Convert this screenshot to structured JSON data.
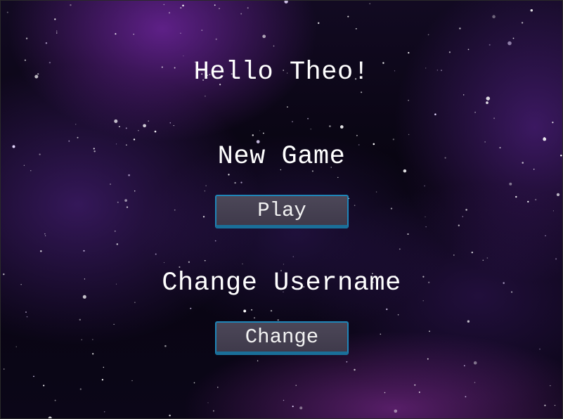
{
  "screen": {
    "greeting": "Hello Theo!",
    "new_game_heading": "New Game",
    "play_button": "Play",
    "change_username_heading": "Change Username",
    "change_button": "Change"
  },
  "colors": {
    "text": "#ffffff",
    "button_fill": "#453f52",
    "button_border": "#1f86b8",
    "background": "#07040f"
  },
  "background": {
    "description_icon": "starfield-nebula"
  }
}
